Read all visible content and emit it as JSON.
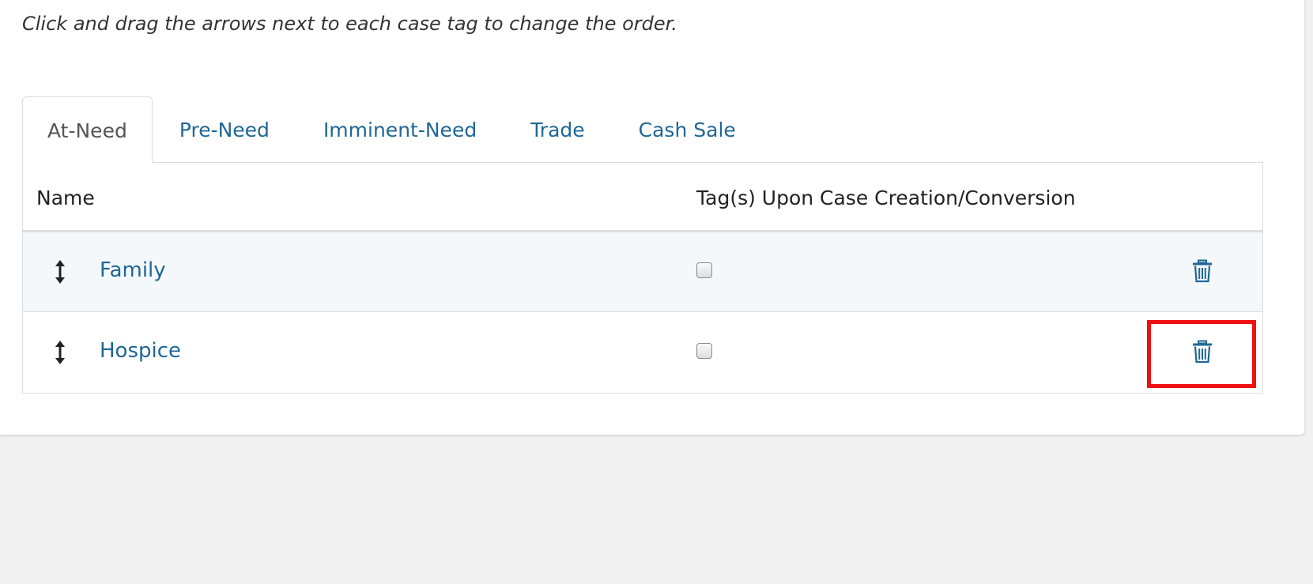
{
  "instruction": "Click and drag the arrows next to each case tag to change the order.",
  "tabs": [
    {
      "label": "At-Need",
      "active": true
    },
    {
      "label": "Pre-Need",
      "active": false
    },
    {
      "label": "Imminent-Need",
      "active": false
    },
    {
      "label": "Trade",
      "active": false
    },
    {
      "label": "Cash Sale",
      "active": false
    }
  ],
  "table": {
    "headers": {
      "name": "Name",
      "tags": "Tag(s) Upon Case Creation/Conversion"
    },
    "rows": [
      {
        "name": "Family",
        "tag_on_creation": false,
        "drag_icon": "drag-vertical-arrows-icon",
        "delete_icon": "trash-icon"
      },
      {
        "name": "Hospice",
        "tag_on_creation": false,
        "drag_icon": "drag-vertical-arrows-icon",
        "delete_icon": "trash-icon"
      }
    ]
  },
  "colors": {
    "link": "#1f6796",
    "active_tab_text": "#555555",
    "row_highlight_bg": "#f4f8fb",
    "annotation_box": "#ee1111",
    "page_bg": "#f1f1f1"
  }
}
